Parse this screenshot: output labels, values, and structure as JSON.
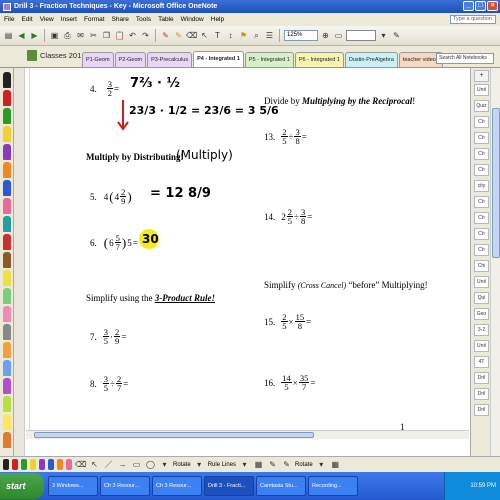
{
  "window": {
    "title": "Drill 3 - Fraction Techniques - Key - Microsoft Office OneNote",
    "buttons": {
      "minimize": "_",
      "maximize": "□",
      "close": "×"
    }
  },
  "menu": {
    "items": [
      "File",
      "Edit",
      "View",
      "Insert",
      "Format",
      "Share",
      "Tools",
      "Table",
      "Window",
      "Help"
    ],
    "help_placeholder": "Type a question"
  },
  "toolbar": {
    "zoom": "125%"
  },
  "notebook": {
    "section_title": "Classes 201...",
    "tabs": [
      "P1-Geom",
      "P2-Geom",
      "P3-Precalculus",
      "P4 - Integrated 1",
      "P5 - Integrated 1",
      "P6 - Integrated 1",
      "Dustin-PreAlgebra",
      "teacher videos"
    ],
    "active_tab_index": 3,
    "tab_colors": [
      "#e8d5f7",
      "#e8d5f7",
      "#e8d5f7",
      "#ffffff",
      "#d7f0c8",
      "#f7f3b0",
      "#c8f0f5",
      "#f7d7c0"
    ],
    "search_placeholder": "Search All Notebooks"
  },
  "page_list": [
    "Unit",
    "Quiz",
    "Ch",
    "Ch",
    "Ch",
    "Ch",
    "city",
    "Ch",
    "Ch",
    "Ch",
    "Ch",
    "Chi",
    "Unit",
    "Qui",
    "Geo",
    "3-2",
    "Unit",
    "4T",
    "Dril",
    "Dril",
    "Dril"
  ],
  "content": {
    "problem_4": {
      "number": "4.",
      "num": "3",
      "den": "2"
    },
    "problem_4_ink": "7⅔ · ½",
    "problem_4_ink_line2": "23/3 · 1/2 = 23/6 = 3 5/6",
    "distribute_heading": "Multiply by Distributing!",
    "distribute_ink": "(Multiply)",
    "problem_5": {
      "number": "5.",
      "whole": "4",
      "num": "2",
      "den": "9",
      "answer_ink": "= 12 8/9"
    },
    "problem_6": {
      "number": "6.",
      "whole": "6",
      "num": "5",
      "den": "7",
      "mult": "5",
      "answer_ink": "30"
    },
    "three_product_prefix": "Simplify using the ",
    "three_product_rule": "3-Product Rule!",
    "problem_7": {
      "number": "7.",
      "a_num": "3",
      "a_den": "5",
      "op": "·",
      "b_num": "2",
      "b_den": "9"
    },
    "problem_8": {
      "number": "8.",
      "a_num": "3",
      "a_den": "5",
      "op": "÷",
      "b_num": "2",
      "b_den": "7"
    },
    "reciprocal_prefix": "Divide by ",
    "reciprocal_italic": "Multiplying by the Reciprocal",
    "reciprocal_suffix": "!",
    "problem_13": {
      "number": "13.",
      "a_num": "2",
      "a_den": "5",
      "op": "÷",
      "b_num": "3",
      "b_den": "8"
    },
    "problem_14": {
      "number": "14.",
      "whole": "2",
      "a_num": "2",
      "a_den": "5",
      "op": "÷",
      "b_num": "3",
      "b_den": "8"
    },
    "cross_prefix": "Simplify ",
    "cross_italic": "(Cross Cancel)",
    "cross_suffix": " “before” Multiplying!",
    "problem_15": {
      "number": "15.",
      "a_num": "2",
      "a_den": "5",
      "op": "×",
      "b_num": "15",
      "b_den": "8"
    },
    "problem_16": {
      "number": "16.",
      "a_num": "14",
      "a_den": "5",
      "op": "×",
      "b_num": "35",
      "b_den": "7"
    },
    "page_number": "1"
  },
  "drawbar": {
    "rotate": "Rotate",
    "rule_lines": "Rule Lines"
  },
  "taskbar": {
    "start": "start",
    "tasks": [
      "3 Windows...",
      "Ch 3 Resour...",
      "Ch 3 Resour...",
      "Drill 3 - Fracti...",
      "Camtasia Stu...",
      "Recording..."
    ],
    "clock": "10:59 PM"
  },
  "equals": "="
}
